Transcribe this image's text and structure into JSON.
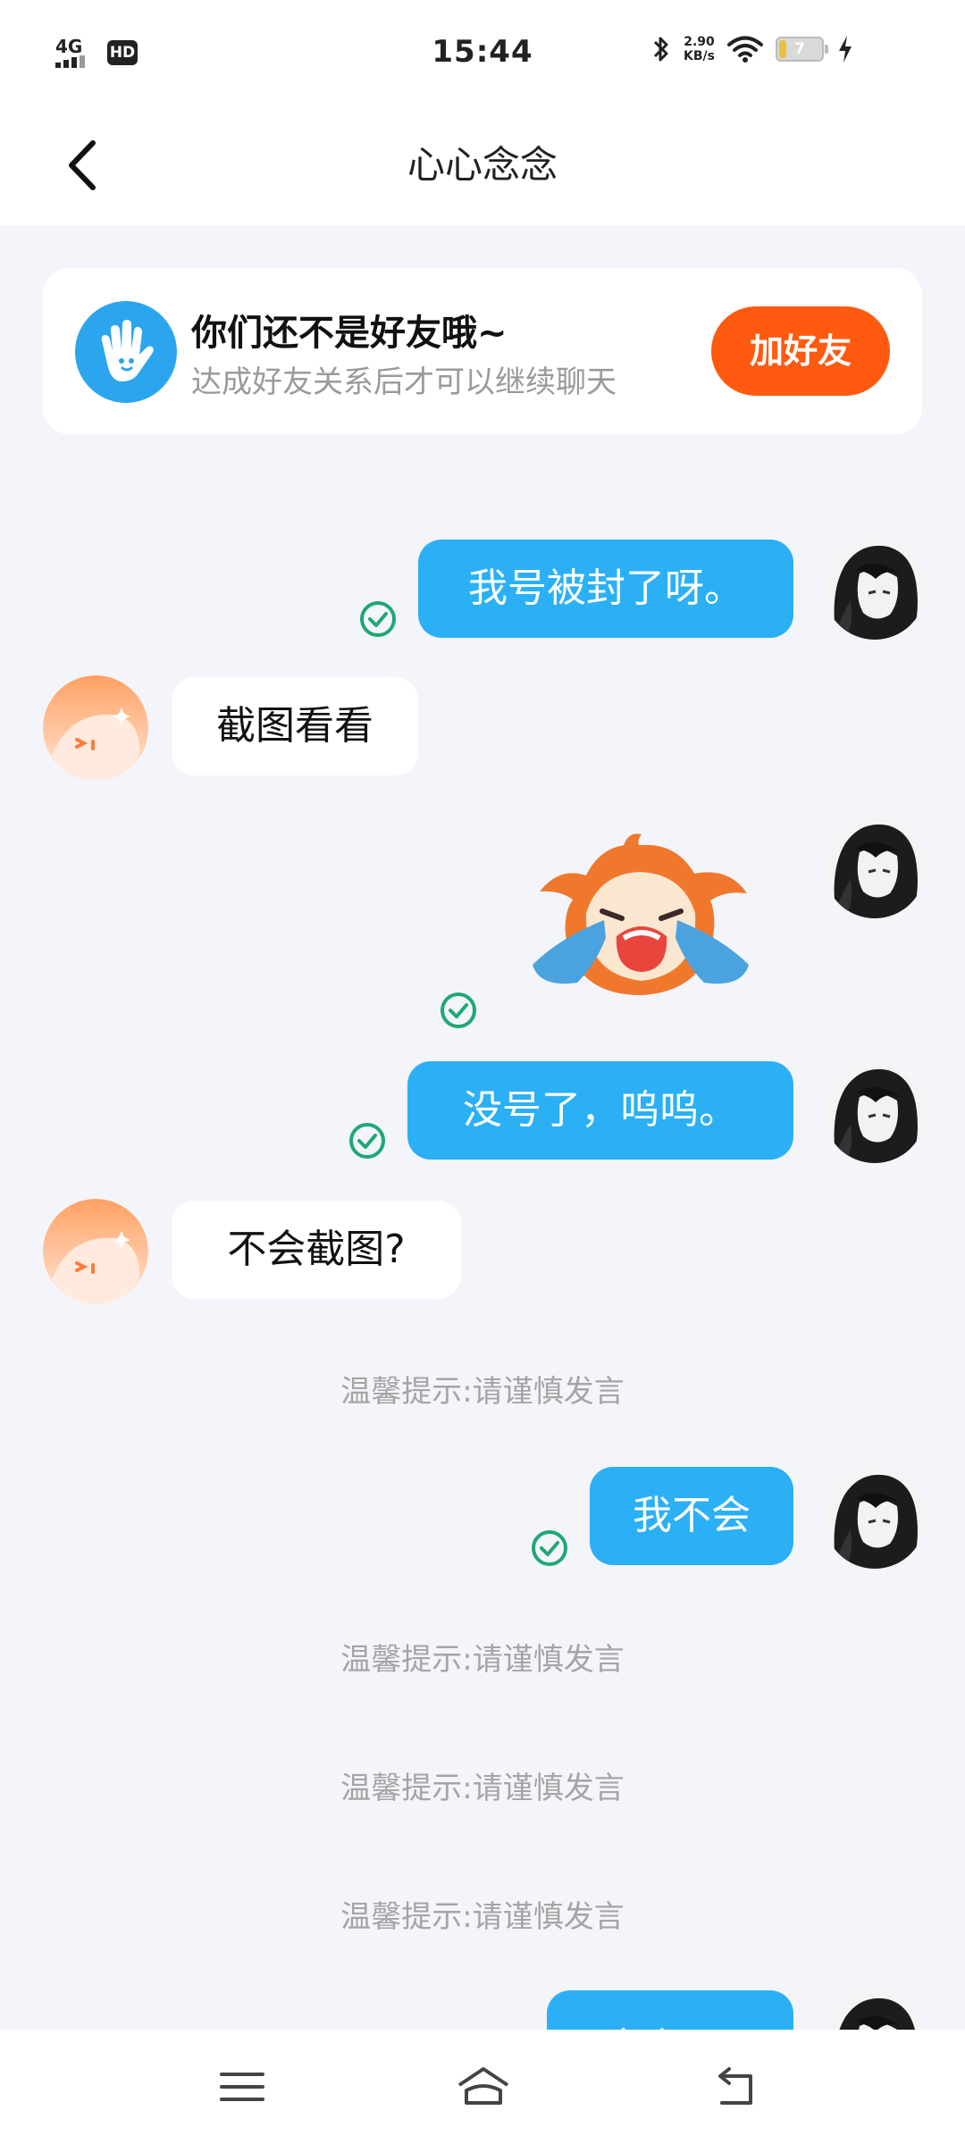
{
  "status_bar": {
    "network": "4G",
    "hd_label": "HD",
    "time": "15:44",
    "speed_value": "2.90",
    "speed_unit": "KB/s",
    "battery": "7"
  },
  "header": {
    "title": "心心念念"
  },
  "friend_banner": {
    "title": "你们还不是好友哦~",
    "subtitle": "达成好友关系后才可以继续聊天",
    "button": "加好友",
    "button_color": "#ff5a10",
    "icon": "waving-hand-icon"
  },
  "messages": [
    {
      "from": "me",
      "text": "我号被封了呀。",
      "status": "sent"
    },
    {
      "from": "other",
      "text": "截图看看"
    },
    {
      "from": "me",
      "type": "sticker",
      "sticker": "crying-cartoon-sticker",
      "status": "sent"
    },
    {
      "from": "me",
      "text": "没号了，呜呜。",
      "status": "sent"
    },
    {
      "from": "other",
      "text": "不会截图?"
    },
    {
      "type": "tip",
      "text": "温馨提示:请谨慎发言"
    },
    {
      "from": "me",
      "text": "我不会",
      "status": "sent"
    },
    {
      "type": "tip",
      "text": "温馨提示:请谨慎发言"
    },
    {
      "type": "tip",
      "text": "温馨提示:请谨慎发言"
    },
    {
      "type": "tip",
      "text": "温馨提示:请谨慎发言"
    },
    {
      "from": "me",
      "text": "这咋弄?",
      "status": "partially-visible"
    }
  ],
  "colors": {
    "my_bubble": "#2bb0f5",
    "other_bubble": "#ffffff",
    "check": "#1fa876",
    "background": "#f3f5fa"
  },
  "nav": {
    "icons": [
      "menu-icon",
      "home-icon",
      "back-icon"
    ]
  }
}
